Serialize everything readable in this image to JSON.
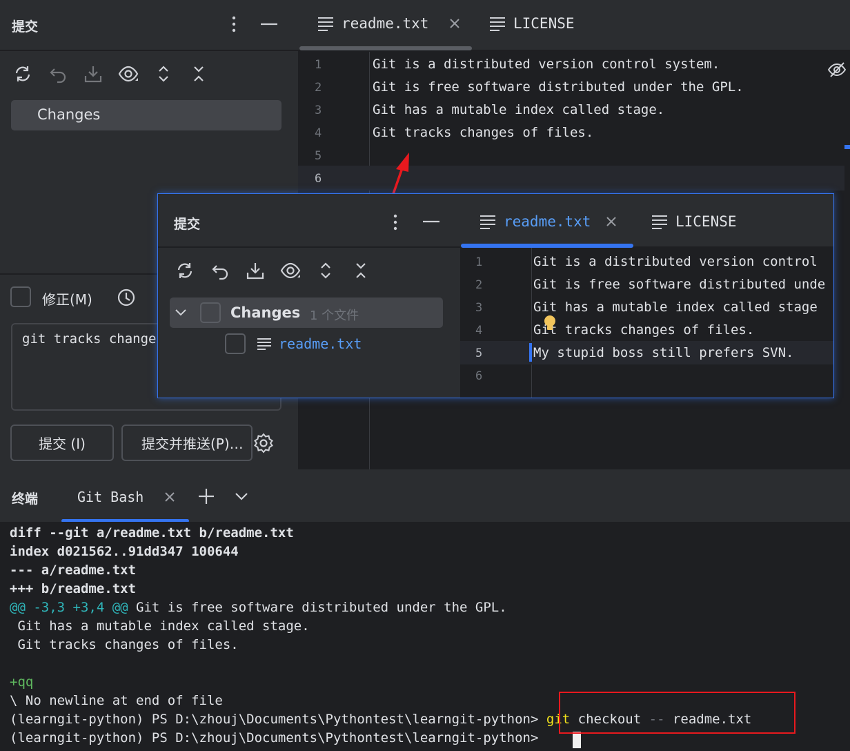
{
  "left_panel": {
    "title": "提交",
    "changes_label": "Changes",
    "amend_label": "修正(M)",
    "commit_message": "git tracks change",
    "commit_button": "提交 (I)",
    "commit_push_button": "提交并推送(P)…"
  },
  "editor": {
    "tabs": [
      {
        "label": "readme.txt",
        "active": true
      },
      {
        "label": "LICENSE",
        "active": false
      }
    ],
    "lines": [
      {
        "no": "1",
        "text": "Git is a distributed version control system."
      },
      {
        "no": "2",
        "text": "Git is free software distributed under the GPL."
      },
      {
        "no": "3",
        "text": "Git has a mutable index called stage."
      },
      {
        "no": "4",
        "text": "Git tracks changes of files."
      },
      {
        "no": "5",
        "text": ""
      },
      {
        "no": "6",
        "text": ""
      }
    ]
  },
  "overlay": {
    "title": "提交",
    "changes_label": "Changes",
    "changes_count": "1 个文件",
    "file_name": "readme.txt",
    "tabs": [
      {
        "label": "readme.txt",
        "active": true
      },
      {
        "label": "LICENSE",
        "active": false
      }
    ],
    "lines": [
      {
        "no": "1",
        "text": "Git is a distributed version control"
      },
      {
        "no": "2",
        "text": "Git is free software distributed unde"
      },
      {
        "no": "3",
        "text": "Git has a mutable index called stage"
      },
      {
        "no": "4",
        "text": "Git tracks changes of files."
      },
      {
        "no": "5",
        "text": "My stupid boss still prefers SVN."
      },
      {
        "no": "6",
        "text": ""
      }
    ]
  },
  "terminal": {
    "title": "终端",
    "tab_label": "Git Bash",
    "lines": {
      "l1": "diff --git a/readme.txt b/readme.txt",
      "l2": "index d021562..91dd347 100644",
      "l3": "--- a/readme.txt",
      "l4": "+++ b/readme.txt",
      "l5_hunk": "@@ -3,3 +3,4 @@",
      "l5_rest": " Git is free software distributed under the GPL.",
      "l6": " Git has a mutable index called stage.",
      "l7": " Git tracks changes of files.",
      "l9": "+qq",
      "l10": "\\ No newline at end of file",
      "prompt": "(learngit-python) PS D:\\zhouj\\Documents\\Pythontest\\learngit-python>",
      "cmd_git": "git",
      "cmd_checkout": "checkout",
      "cmd_dashes": "--",
      "cmd_file": "readme.txt"
    }
  },
  "colors": {
    "accent": "#3574f0",
    "annotation_red": "#e8191e",
    "hunk_cyan": "#2fb5b9",
    "added_green": "#5fb85f",
    "git_yellow": "#f2e31b",
    "file_blue": "#589df6"
  }
}
